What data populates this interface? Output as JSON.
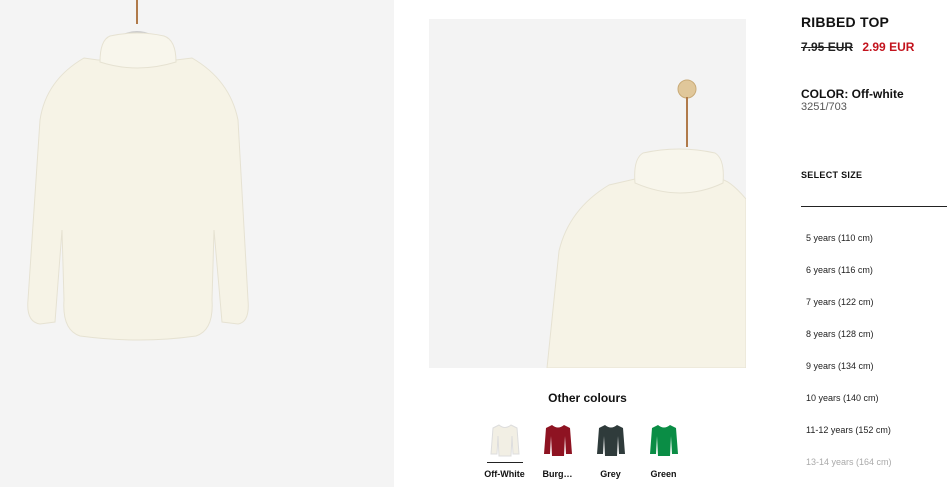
{
  "product": {
    "title": "RIBBED TOP",
    "old_price": "7.95 EUR",
    "new_price": "2.99 EUR",
    "color_label": "COLOR: Off-white",
    "reference": "3251/703"
  },
  "gallery": {
    "main_image_icon": "offwhite-turtleneck-on-hanger",
    "detail_image_icon": "turtleneck-detail-on-hanger"
  },
  "other_colours": {
    "title": "Other colours",
    "items": [
      {
        "label": "Off-White",
        "color": "#f2efe4",
        "selected": true
      },
      {
        "label": "Burg…",
        "color": "#8e1322",
        "selected": false
      },
      {
        "label": "Grey",
        "color": "#2f3b3b",
        "selected": false
      },
      {
        "label": "Green",
        "color": "#0a8d45",
        "selected": false
      }
    ]
  },
  "size_selector": {
    "heading": "SELECT SIZE",
    "sizes": [
      {
        "label": "5 years (110 cm)",
        "available": true
      },
      {
        "label": "6 years (116 cm)",
        "available": true
      },
      {
        "label": "7 years (122 cm)",
        "available": true
      },
      {
        "label": "8 years (128 cm)",
        "available": true
      },
      {
        "label": "9 years (134 cm)",
        "available": true
      },
      {
        "label": "10 years (140 cm)",
        "available": true
      },
      {
        "label": "11-12 years (152 cm)",
        "available": true
      },
      {
        "label": "13-14 years (164 cm)",
        "available": false
      }
    ]
  },
  "colors": {
    "sale": "#c3141e",
    "garment": "#f6f3e6"
  }
}
